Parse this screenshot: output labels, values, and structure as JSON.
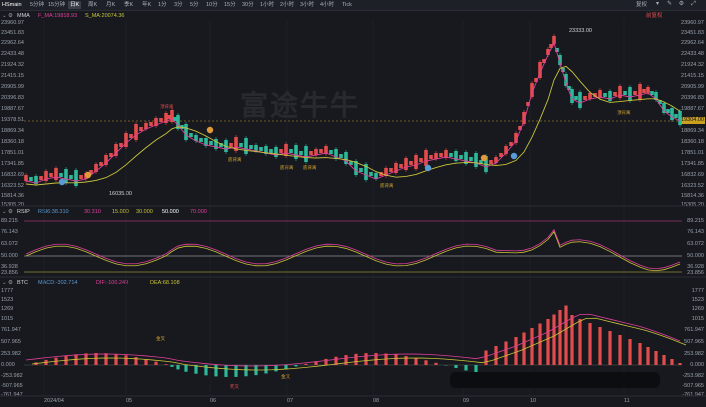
{
  "toolbar": {
    "symbol": "HSmain",
    "timeframes": [
      "5分钟",
      "15分钟",
      "日K",
      "周K",
      "月K",
      "季K",
      "年K",
      "1分",
      "3分",
      "5分",
      "10分",
      "15分",
      "30分",
      "1小时",
      "2小时",
      "3小时",
      "4小时",
      "Tick"
    ],
    "active_index": 2,
    "right_label": "复权"
  },
  "main_panel": {
    "indicator": "MMA",
    "f_ma": "F_MA:19818.93",
    "s_ma": "S_MA:20074.36",
    "right_badge": "前复权",
    "y_labels": [
      "23960.97",
      "23451.83",
      "22962.64",
      "22433.48",
      "21924.32",
      "21415.15",
      "20905.99",
      "20396.83",
      "19887.67",
      "19378.51",
      "18869.34",
      "18360.18",
      "17851.01",
      "17341.85",
      "16832.69",
      "16323.52",
      "15814.36",
      "15305.20"
    ],
    "current_price": "19304.00",
    "high_label": "23333.00",
    "low_label": "16035.00"
  },
  "rsi_panel": {
    "indicator": "RSIP",
    "values": [
      "RSI6:38.310",
      "30.310",
      "15.000",
      "30.000",
      "50.000",
      "70.000"
    ],
    "y_labels_left": [
      "89.215",
      "76.143",
      "63.072",
      "50.000",
      "36.928",
      "23.856"
    ],
    "y_labels_right": [
      "89.215",
      "76.143",
      "63.072",
      "50.000",
      "36.928",
      "23.856"
    ]
  },
  "macd_panel": {
    "indicator": "BTC",
    "values": [
      "MACD:-302.714",
      "DIF:-100.249",
      "DEA:68.108"
    ],
    "y_labels_left": [
      "1777",
      "1523",
      "1269",
      "1015",
      "761.947",
      "507.965",
      "253.982",
      "0.000",
      "-253.982",
      "-507.965",
      "-761.947"
    ],
    "y_labels_right": [
      "1777",
      "1523",
      "1269",
      "1015",
      "761.947",
      "507.965",
      "253.982",
      "0.000",
      "-253.982",
      "-507.965",
      "-761.947"
    ]
  },
  "x_axis": [
    "2024/04",
    "05",
    "06",
    "07",
    "08",
    "09",
    "10",
    "11"
  ],
  "annotations": {
    "top_sell": "顶背离",
    "bottom_buy": "底背离",
    "golden": "金叉",
    "dead": "死叉"
  },
  "watermark": "富途牛牛",
  "colors": {
    "up": "#e24c4c",
    "down": "#2db89a",
    "fast": "#e0409a",
    "slow": "#c9c43a",
    "bg": "#17191f"
  }
}
